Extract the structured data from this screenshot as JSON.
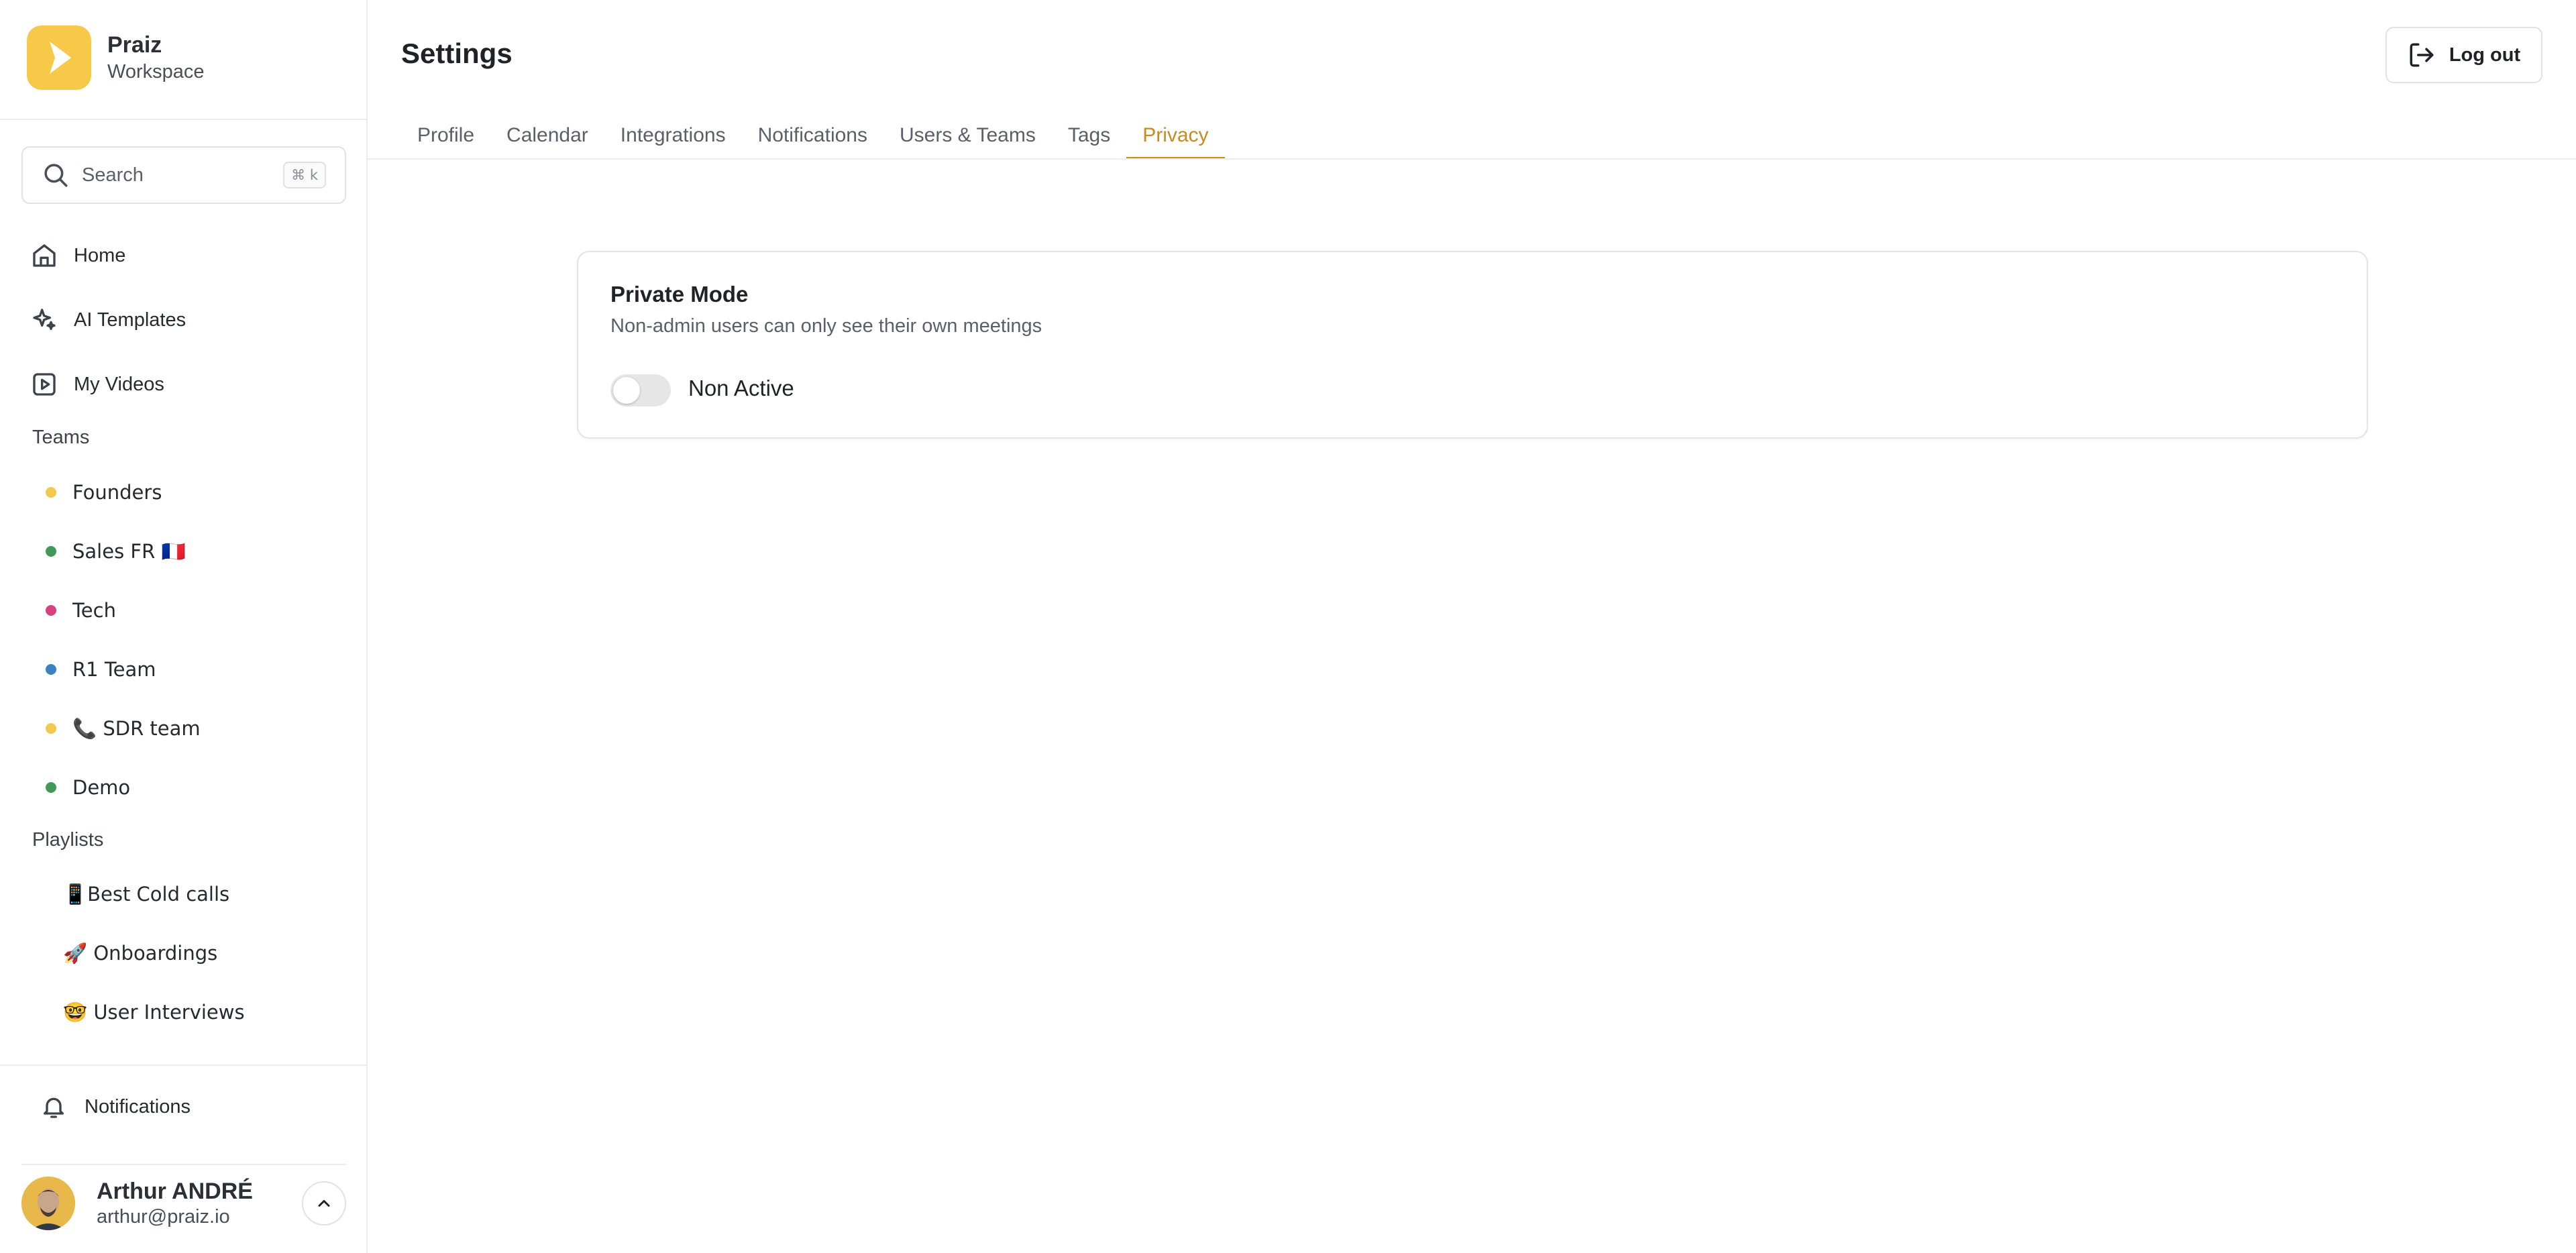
{
  "workspace": {
    "name": "Praiz",
    "subtitle": "Workspace",
    "brand_color": "#f7c948"
  },
  "search": {
    "placeholder": "Search",
    "shortcut": "⌘ k"
  },
  "nav": [
    {
      "label": "Home",
      "icon": "home-icon"
    },
    {
      "label": "AI Templates",
      "icon": "sparkles-icon"
    },
    {
      "label": "My Videos",
      "icon": "play-square-icon"
    }
  ],
  "teams": {
    "label": "Teams",
    "items": [
      {
        "label": "Founders",
        "color": "#f2c94c"
      },
      {
        "label": "Sales FR 🇫🇷",
        "color": "#3f9a5a"
      },
      {
        "label": "Tech",
        "color": "#d9407f"
      },
      {
        "label": "R1 Team",
        "color": "#3b82c4"
      },
      {
        "label": "📞 SDR team",
        "color": "#f2c94c"
      },
      {
        "label": "Demo",
        "color": "#3f9a5a"
      }
    ]
  },
  "playlists": {
    "label": "Playlists",
    "items": [
      {
        "label": "📱Best Cold calls"
      },
      {
        "label": "🚀 Onboardings"
      },
      {
        "label": "🤓 User Interviews"
      }
    ]
  },
  "footer": {
    "notifications_label": "Notifications",
    "user_name": "Arthur ANDRÉ",
    "user_email": "arthur@praiz.io"
  },
  "header": {
    "title": "Settings",
    "logout_label": "Log out"
  },
  "tabs": [
    {
      "label": "Profile",
      "active": false
    },
    {
      "label": "Calendar",
      "active": false
    },
    {
      "label": "Integrations",
      "active": false
    },
    {
      "label": "Notifications",
      "active": false
    },
    {
      "label": "Users & Teams",
      "active": false
    },
    {
      "label": "Tags",
      "active": false
    },
    {
      "label": "Privacy",
      "active": true
    }
  ],
  "privacy": {
    "title": "Private Mode",
    "description": "Non-admin users can only see their own meetings",
    "toggle_state": "Non Active",
    "enabled": false
  },
  "colors": {
    "accent": "#c98a1e",
    "border": "#e4e4e4"
  }
}
